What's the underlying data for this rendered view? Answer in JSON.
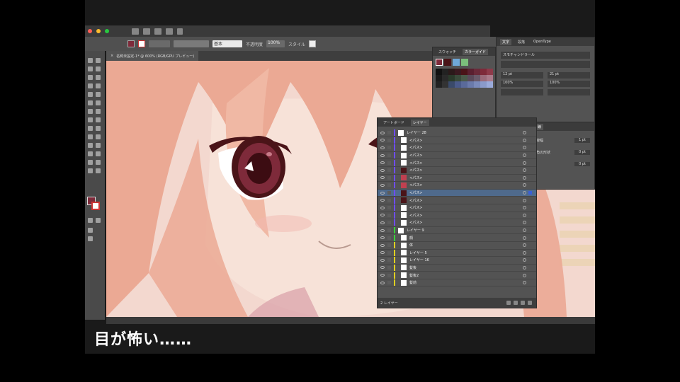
{
  "subtitle": "目が怖い……",
  "colors": {
    "bg_black": "#000000",
    "ui_dark": "#3a3a3a",
    "ui_mid": "#535353",
    "hair_pink": "#eba994",
    "skin": "#f5dcd2",
    "eye_dark": "#4a1418",
    "iris": "#7e2a3a",
    "layer_selected": "#4f6a8c"
  },
  "document_tab": {
    "title": "名称未設定-1* @ 600% (RGB/GPU プレビュー)"
  },
  "controlbar": {
    "stroke_label": "基本",
    "opacity_label": "不透明度",
    "opacity_value": "100%",
    "style_label": "スタイル"
  },
  "swatch_panel": {
    "tabs": [
      "スウォッチ",
      "カラーガイド"
    ],
    "active": "カラーガイド"
  },
  "char_panel": {
    "tabs": [
      "文字",
      "段落",
      "OpenType"
    ],
    "font": "スモチャンドラール",
    "size": "12 pt",
    "leading": "21 pt",
    "scale_h": "100%",
    "scale_v": "100%"
  },
  "layers_panel": {
    "tabs": [
      "アートボード",
      "レイヤー"
    ],
    "active_tab": "レイヤー",
    "footer_count": "2 レイヤー",
    "layers": [
      {
        "name": "レイヤー 28",
        "kind": "group",
        "thumb": "plain",
        "color": "#6f4cff"
      },
      {
        "name": "<パス>",
        "kind": "path",
        "thumb": "plain",
        "color": "#6f4cff"
      },
      {
        "name": "<パス>",
        "kind": "path",
        "thumb": "plain",
        "color": "#6f4cff"
      },
      {
        "name": "<パス>",
        "kind": "path",
        "thumb": "plain",
        "color": "#6f4cff"
      },
      {
        "name": "<パス>",
        "kind": "path",
        "thumb": "plain",
        "color": "#6f4cff"
      },
      {
        "name": "<パス>",
        "kind": "path",
        "thumb": "dark",
        "color": "#6f4cff"
      },
      {
        "name": "<パス>",
        "kind": "path",
        "thumb": "red",
        "color": "#6f4cff"
      },
      {
        "name": "<パス>",
        "kind": "path",
        "thumb": "red",
        "color": "#6f4cff"
      },
      {
        "name": "<パス>",
        "kind": "path",
        "thumb": "dark",
        "color": "#6f4cff",
        "selected": true
      },
      {
        "name": "<パス>",
        "kind": "path",
        "thumb": "dark",
        "color": "#6f4cff"
      },
      {
        "name": "<パス>",
        "kind": "path",
        "thumb": "plain",
        "color": "#6f4cff"
      },
      {
        "name": "<パス>",
        "kind": "path",
        "thumb": "plain",
        "color": "#6f4cff"
      },
      {
        "name": "<パス>",
        "kind": "path",
        "thumb": "plain",
        "color": "#6f4cff"
      },
      {
        "name": "レイヤー 9",
        "kind": "group",
        "thumb": "plain",
        "color": "#3ad23a"
      },
      {
        "name": "顔",
        "kind": "sub",
        "thumb": "plain",
        "color": "#3ad23a"
      },
      {
        "name": "体",
        "kind": "sub",
        "thumb": "plain",
        "color": "#e0d020"
      },
      {
        "name": "レイヤー 5",
        "kind": "sub",
        "thumb": "plain",
        "color": "#e0d020"
      },
      {
        "name": "レイヤー 16",
        "kind": "sub",
        "thumb": "plain",
        "color": "#e0d020"
      },
      {
        "name": "髪後",
        "kind": "sub",
        "thumb": "plain",
        "color": "#e0d020"
      },
      {
        "name": "髪後2",
        "kind": "sub",
        "thumb": "plain",
        "color": "#e0d020"
      },
      {
        "name": "髪前",
        "kind": "sub",
        "thumb": "plain",
        "color": "#e0d020"
      }
    ]
  },
  "props_panel": {
    "labels": [
      "線",
      "線幅",
      "角の形状"
    ],
    "values": [
      "1 pt",
      "0 pt",
      "0 pt"
    ]
  }
}
